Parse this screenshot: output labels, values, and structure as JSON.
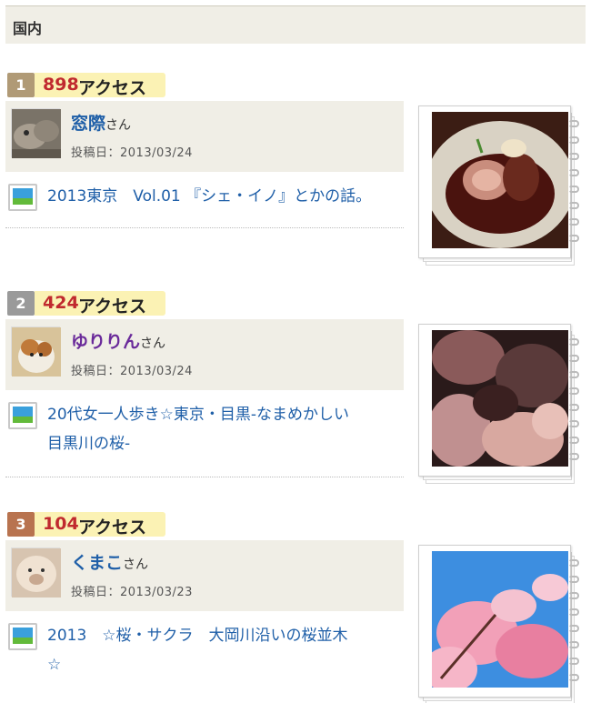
{
  "header": {
    "title": "国内"
  },
  "entries": [
    {
      "rank": "1",
      "count": "898",
      "suffix": "アクセス",
      "rank_color": "#b09a76",
      "user_name": "窓際",
      "user_color": "#1f5fa8",
      "san": "さん",
      "date": "投稿日：2013/03/24",
      "title": "2013東京　Vol.01 『シェ・イノ』とかの話。",
      "photo_icon": "food-photo"
    },
    {
      "rank": "2",
      "count": "424",
      "suffix": "アクセス",
      "rank_color": "#9a9a9a",
      "user_name": "ゆりりん",
      "user_color": "#6a2a9a",
      "san": "さん",
      "date": "投稿日：2013/03/24",
      "title_line1": "20代女一人歩き☆東京・目黒-なまめかしい",
      "title_line2": "目黒川の桜-",
      "photo_icon": "night-cherry-blossom-photo"
    },
    {
      "rank": "3",
      "count": "104",
      "suffix": "アクセス",
      "rank_color": "#b8734f",
      "user_name": "くまこ",
      "user_color": "#1f5fa8",
      "san": "さん",
      "date": "投稿日：2013/03/23",
      "title_line1": "2013　☆桜・サクラ　大岡川沿いの桜並木",
      "title_line2": "☆",
      "photo_icon": "cherry-blossom-photo"
    }
  ]
}
